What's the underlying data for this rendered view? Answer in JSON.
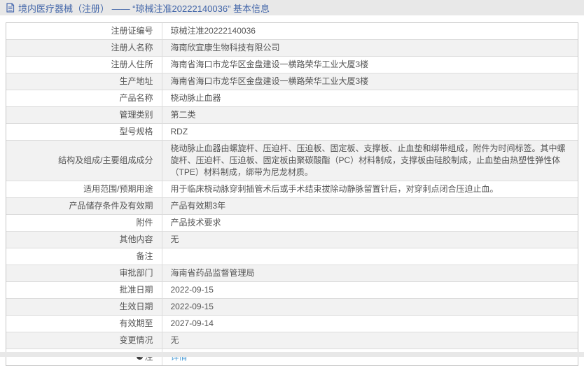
{
  "header": {
    "icon": "document-icon",
    "title": "境内医疗器械（注册） —— “琼械注准20222140036” 基本信息"
  },
  "colors": {
    "title_blue": "#4064a8",
    "link_blue": "#4b9cd6",
    "stripe_gray": "#f2f2f2",
    "bar_gray": "#e8e8e8",
    "border_gray": "#c6c6c6",
    "text_gray": "#555555"
  },
  "table": {
    "rows": [
      {
        "label": "注册证编号",
        "value": "琼械注准20222140036"
      },
      {
        "label": "注册人名称",
        "value": "海南欣宜康生物科技有限公司"
      },
      {
        "label": "注册人住所",
        "value": "海南省海口市龙华区金盘建设一横路荣华工业大厦3楼"
      },
      {
        "label": "生产地址",
        "value": "海南省海口市龙华区金盘建设一横路荣华工业大厦3楼"
      },
      {
        "label": "产品名称",
        "value": "桡动脉止血器"
      },
      {
        "label": "管理类别",
        "value": "第二类"
      },
      {
        "label": "型号规格",
        "value": "RDZ"
      },
      {
        "label": "结构及组成/主要组成成分",
        "value": "桡动脉止血器由螺旋杆、压迫杆、压迫板、固定板、支撑板、止血垫和绑带组成，附件为时间标签。其中螺旋杆、压迫杆、压迫板、固定板由聚碳酸酯（PC）材料制成，支撑板由硅胶制成，止血垫由热塑性弹性体（TPE）材料制成，绑带为尼龙材质。"
      },
      {
        "label": "适用范围/预期用途",
        "value": "用于临床桡动脉穿刺插管术后或手术结束拔除动静脉留置针后，对穿刺点闭合压迫止血。"
      },
      {
        "label": "产品储存条件及有效期",
        "value": "产品有效期3年"
      },
      {
        "label": "附件",
        "value": "产品技术要求"
      },
      {
        "label": "其他内容",
        "value": "无"
      },
      {
        "label": "备注",
        "value": ""
      },
      {
        "label": "审批部门",
        "value": "海南省药品监督管理局"
      },
      {
        "label": "批准日期",
        "value": "2022-09-15"
      },
      {
        "label": "生效日期",
        "value": "2022-09-15"
      },
      {
        "label": "有效期至",
        "value": "2027-09-14"
      },
      {
        "label": "变更情况",
        "value": "无"
      },
      {
        "label": "注",
        "value": "详情",
        "link": true,
        "icon": "note-icon"
      }
    ]
  }
}
